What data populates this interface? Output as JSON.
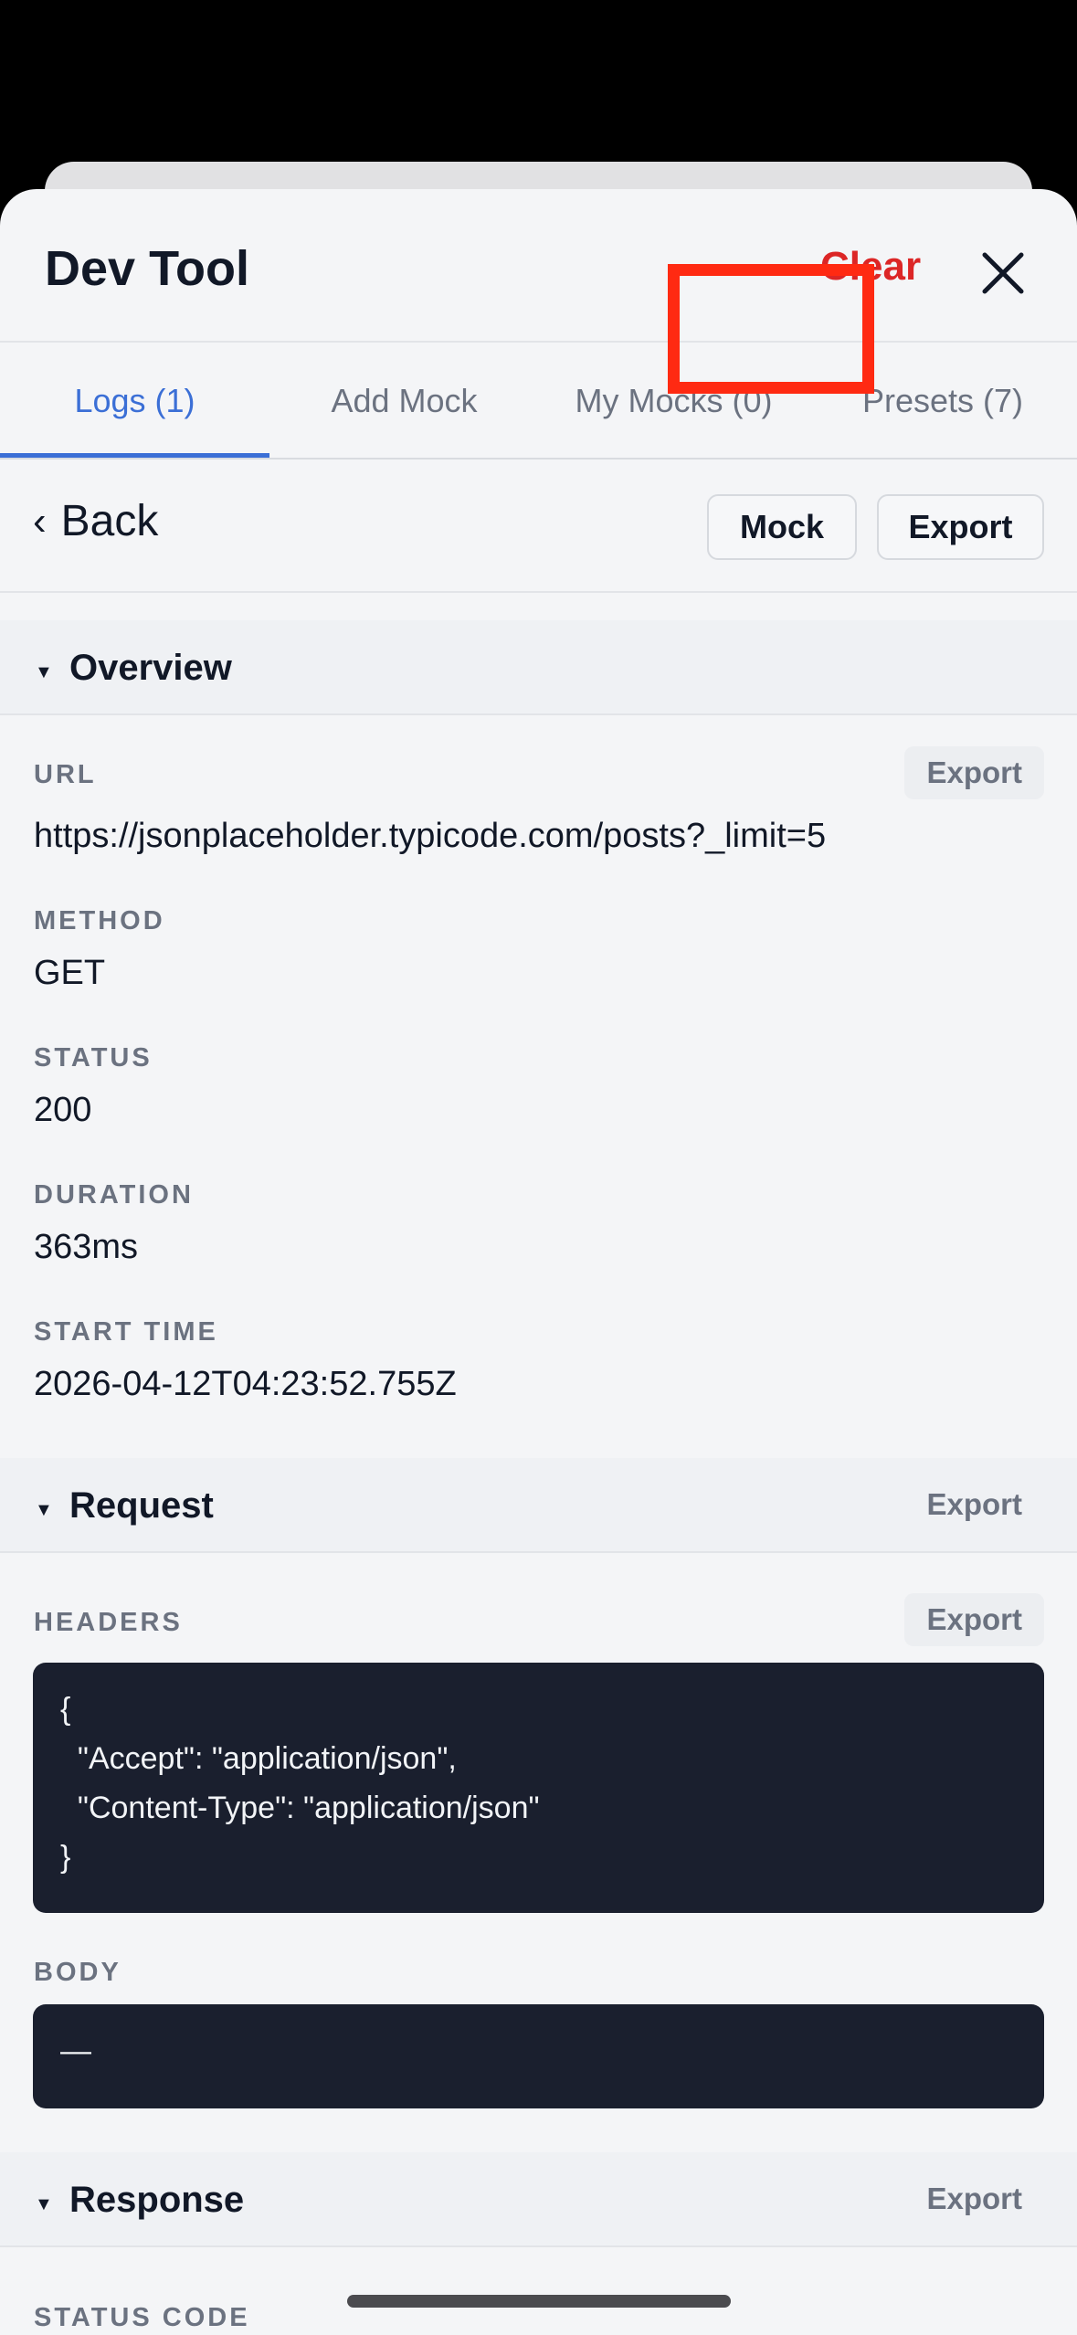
{
  "header": {
    "title": "Dev Tool",
    "clear_label": "Clear"
  },
  "tabs": [
    {
      "label": "Logs (1)",
      "active": true
    },
    {
      "label": "Add Mock",
      "active": false
    },
    {
      "label": "My Mocks (0)",
      "active": false
    },
    {
      "label": "Presets (7)",
      "active": false
    }
  ],
  "toolbar": {
    "back_label": "Back",
    "mock_label": "Mock",
    "export_label": "Export"
  },
  "overview": {
    "title": "Overview",
    "url_label": "URL",
    "url_export": "Export",
    "url": "https://jsonplaceholder.typicode.com/posts?_limit=5",
    "method_label": "METHOD",
    "method": "GET",
    "status_label": "STATUS",
    "status": "200",
    "duration_label": "DURATION",
    "duration": "363ms",
    "start_label": "START TIME",
    "start": "2026-04-12T04:23:52.755Z"
  },
  "request": {
    "title": "Request",
    "export_label": "Export",
    "headers_label": "HEADERS",
    "headers_export": "Export",
    "headers_code": "{\n  \"Accept\": \"application/json\",\n  \"Content-Type\": \"application/json\"\n}",
    "body_label": "BODY",
    "body_code": "—"
  },
  "response": {
    "title": "Response",
    "export_label": "Export",
    "status_code_label": "STATUS CODE"
  },
  "colors": {
    "accent": "#3b6fd6",
    "danger": "#dc2626",
    "highlight": "#ff2a12",
    "code_bg": "#1a1f2e"
  }
}
